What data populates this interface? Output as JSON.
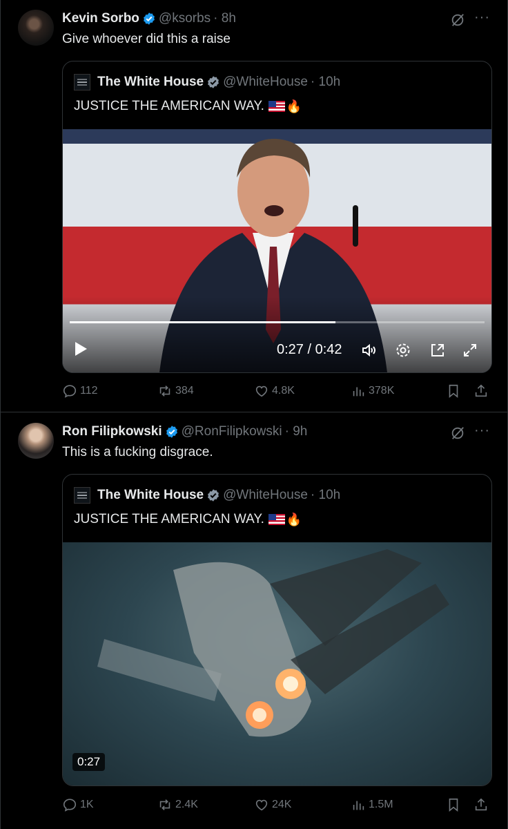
{
  "tweets": [
    {
      "author": "Kevin Sorbo",
      "handle": "@ksorbs",
      "time": "· 8h",
      "text": "Give whoever did this a raise",
      "quote": {
        "author": "The White House",
        "handle": "@WhiteHouse",
        "time": "· 10h",
        "text": "JUSTICE THE AMERICAN WAY.",
        "video": {
          "time_label": "0:27 / 0:42",
          "progress": 0.64
        }
      },
      "stats": {
        "replies": "112",
        "reposts": "384",
        "likes": "4.8K",
        "views": "378K"
      }
    },
    {
      "author": "Ron Filipkowski",
      "handle": "@RonFilipkowski",
      "time": "· 9h",
      "text": "This is a fucking disgrace.",
      "quote": {
        "author": "The White House",
        "handle": "@WhiteHouse",
        "time": "· 10h",
        "text": "JUSTICE THE AMERICAN WAY.",
        "video": {
          "duration": "0:27"
        }
      },
      "stats": {
        "replies": "1K",
        "reposts": "2.4K",
        "likes": "24K",
        "views": "1.5M"
      }
    }
  ],
  "colors": {
    "verified_blue": "#1d9bf0",
    "verified_gold": "#d4a72c",
    "muted": "#71767b"
  },
  "more_label": "···"
}
